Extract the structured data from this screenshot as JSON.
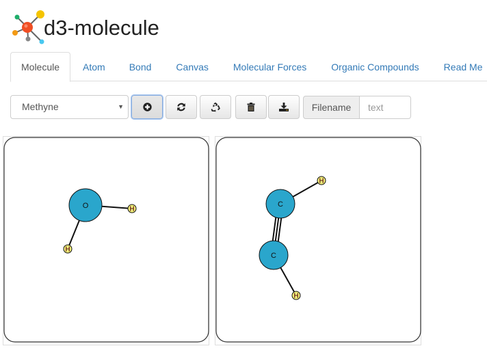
{
  "app": {
    "title": "d3-molecule",
    "logo_icon": "molecule-logo-icon"
  },
  "tabs": [
    {
      "label": "Molecule",
      "active": true
    },
    {
      "label": "Atom",
      "active": false
    },
    {
      "label": "Bond",
      "active": false
    },
    {
      "label": "Canvas",
      "active": false
    },
    {
      "label": "Molecular Forces",
      "active": false
    },
    {
      "label": "Organic Compounds",
      "active": false
    },
    {
      "label": "Read Me",
      "active": false
    }
  ],
  "toolbar": {
    "molecule_select": {
      "value": "Methyne"
    },
    "buttons": [
      {
        "name": "add",
        "icon": "plus-circle-icon",
        "focused": true
      },
      {
        "name": "refresh",
        "icon": "refresh-icon",
        "focused": false
      },
      {
        "name": "recycle",
        "icon": "recycle-icon",
        "focused": false
      },
      {
        "name": "delete",
        "icon": "trash-icon",
        "focused": false
      },
      {
        "name": "download",
        "icon": "download-icon",
        "focused": false
      }
    ],
    "filename_label": "Filename",
    "filename_value": "",
    "filename_placeholder": "text"
  },
  "colors": {
    "link": "#337ab7",
    "heavy_atom": "#2aa6cc",
    "hydrogen": "#f3f07a",
    "hydrogen_text": "#b02a1a"
  },
  "molecules": [
    {
      "name": "water",
      "atoms": [
        {
          "id": 0,
          "symbol": "O",
          "kind": "heavy"
        },
        {
          "id": 1,
          "symbol": "H",
          "kind": "hydrogen"
        },
        {
          "id": 2,
          "symbol": "H",
          "kind": "hydrogen"
        }
      ],
      "bonds": [
        {
          "source": 0,
          "target": 1,
          "order": 1
        },
        {
          "source": 0,
          "target": 2,
          "order": 1
        }
      ]
    },
    {
      "name": "ethyne",
      "atoms": [
        {
          "id": 0,
          "symbol": "C",
          "kind": "heavy"
        },
        {
          "id": 1,
          "symbol": "C",
          "kind": "heavy"
        },
        {
          "id": 2,
          "symbol": "H",
          "kind": "hydrogen"
        },
        {
          "id": 3,
          "symbol": "H",
          "kind": "hydrogen"
        }
      ],
      "bonds": [
        {
          "source": 0,
          "target": 1,
          "order": 3
        },
        {
          "source": 0,
          "target": 2,
          "order": 1
        },
        {
          "source": 1,
          "target": 3,
          "order": 1
        }
      ]
    }
  ]
}
